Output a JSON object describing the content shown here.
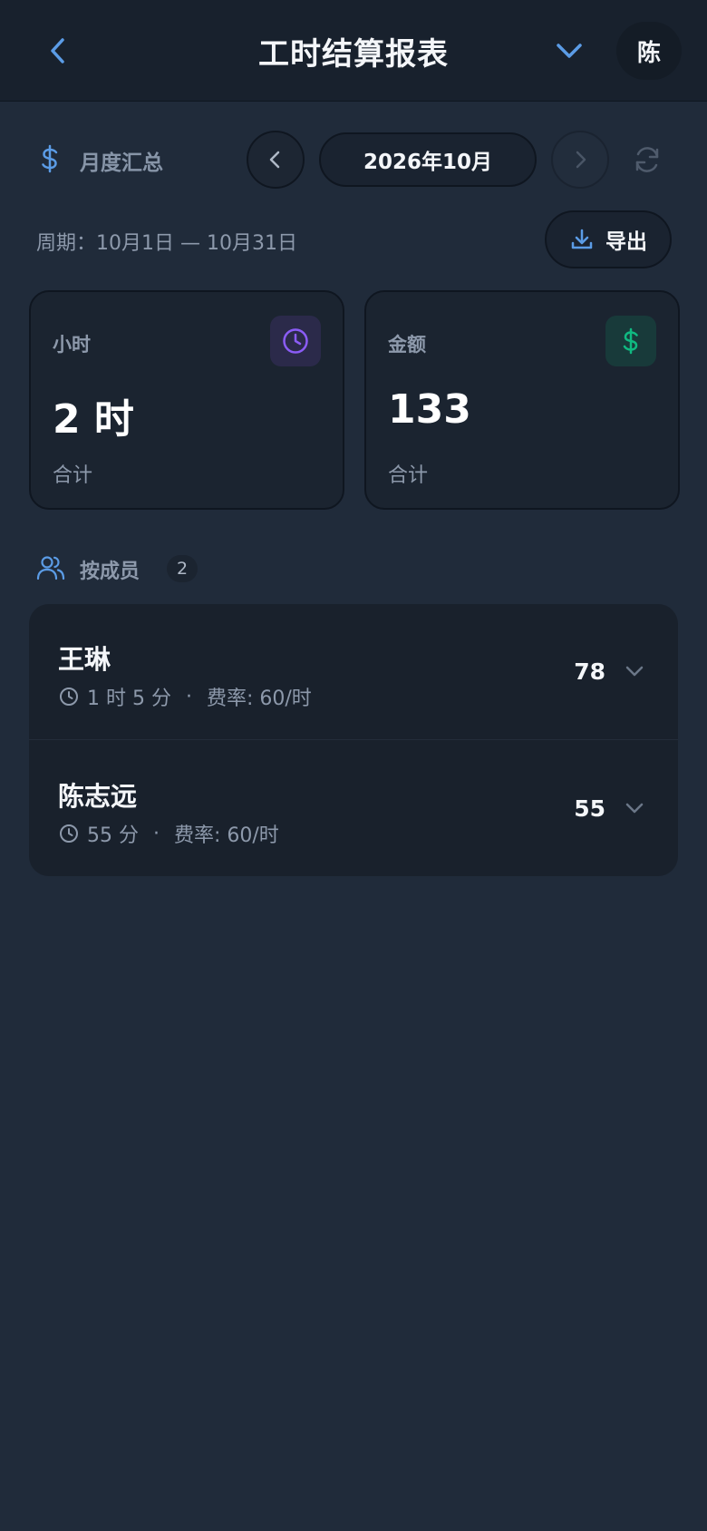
{
  "header": {
    "title": "工时结算报表",
    "avatar_text": "陈"
  },
  "summary": {
    "label": "月度汇总",
    "month": "2026年10月",
    "period": "周期：10月1日 — 10月31日",
    "export_label": "导出"
  },
  "stats": {
    "hours": {
      "label": "小时",
      "value": "2 时",
      "sub": "合计"
    },
    "amount": {
      "label": "金额",
      "value": "133",
      "sub": "合计"
    }
  },
  "members": {
    "label": "按成员",
    "count": "2",
    "items": [
      {
        "name": "王琳",
        "duration": "1 时 5 分",
        "dot": "·",
        "rate": "费率: 60/时",
        "amount": "78"
      },
      {
        "name": "陈志远",
        "duration": "55 分",
        "dot": "·",
        "rate": "费率: 60/时",
        "amount": "55"
      }
    ]
  },
  "colors": {
    "accent_blue": "#5b9ce6",
    "purple": "#8b5cf6",
    "green": "#10b981",
    "background": "#202b3a"
  },
  "icons": [
    "chevron-left-icon",
    "chevron-down-icon",
    "dollar-icon",
    "chevron-right-icon",
    "refresh-icon",
    "download-icon",
    "clock-icon",
    "users-icon"
  ]
}
